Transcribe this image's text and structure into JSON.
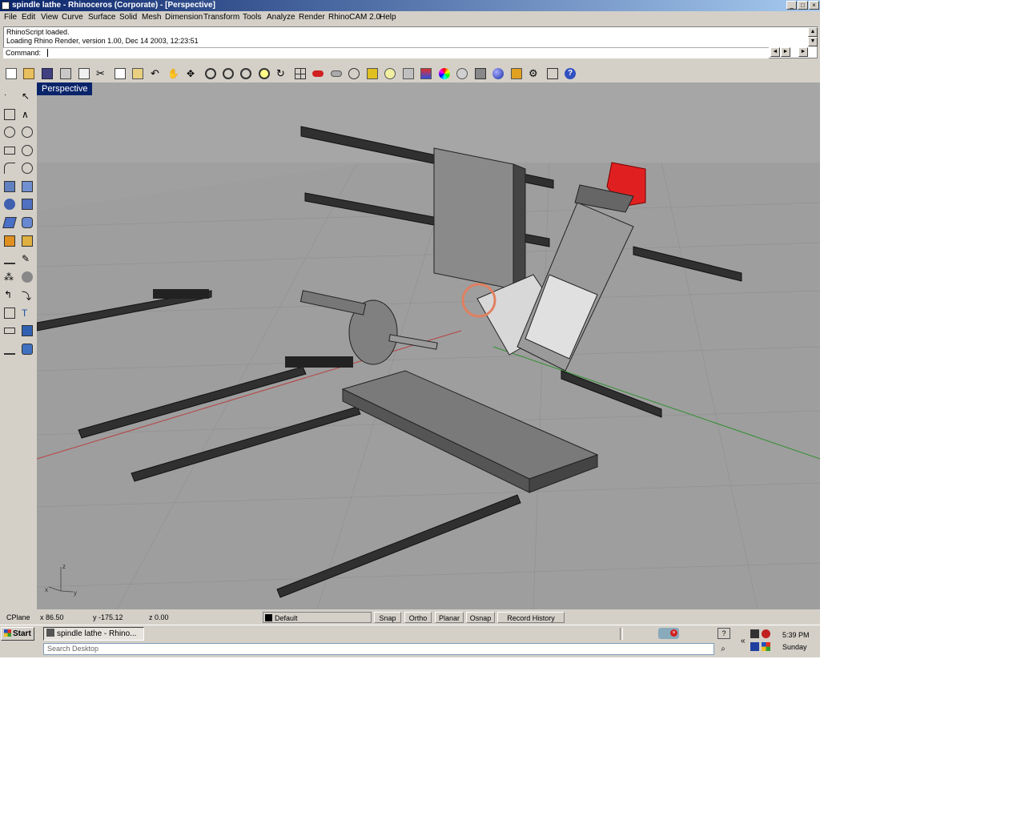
{
  "window": {
    "title": "spindle lathe - Rhinoceros (Corporate) - [Perspective]",
    "controls": [
      "_",
      "□",
      "×"
    ]
  },
  "menu": [
    "File",
    "Edit",
    "View",
    "Curve",
    "Surface",
    "Solid",
    "Mesh",
    "Dimension",
    "Transform",
    "Tools",
    "Analyze",
    "Render",
    "RhinoCAM 2.0",
    "Help"
  ],
  "command": {
    "history": [
      "RhinoScript loaded.",
      "Loading Rhino Render, version 1.00, Dec 14 2003, 12:23:51"
    ],
    "prompt": "Command:"
  },
  "toolbar_icons": [
    "new-file-icon",
    "open-icon",
    "save-icon",
    "print-icon",
    "import-icon",
    "cut-icon",
    "copy-icon",
    "paste-icon",
    "undo-icon",
    "pan-icon",
    "rotate-view-icon",
    "zoom-window-icon",
    "zoom-dynamic-icon",
    "zoom-extents-icon",
    "zoom-selected-icon",
    "undo-view-icon",
    "four-viewports-icon",
    "car-icon",
    "car-outline-icon",
    "osnap-icon",
    "move-icon",
    "light-icon",
    "lock-icon",
    "layer-icon",
    "color-wheel-icon",
    "shaded-icon",
    "render-preview-icon",
    "sphere-render-icon",
    "flag-icon",
    "gear-icon",
    "options-icon",
    "help-icon"
  ],
  "left_tools": [
    "point-icon",
    "select-icon",
    "polyline-icon",
    "curve-icon",
    "circle-icon",
    "arc-icon",
    "rectangle-icon",
    "ellipse-icon",
    "fillet-icon",
    "polygon-icon",
    "surface-icon",
    "nurbs-surface-icon",
    "sphere-icon",
    "box-icon",
    "extrude-icon",
    "cylinder-icon",
    "boolean-icon",
    "solid-edit-icon",
    "split-icon",
    "trim-icon",
    "group-icon",
    "explode-icon",
    "array-icon",
    "offset-icon",
    "scale-icon",
    "transform-icon",
    "dimension-icon",
    "render-icon"
  ],
  "viewport": {
    "label": "Perspective",
    "axis_labels": {
      "z": "z",
      "x": "x",
      "y": "y"
    }
  },
  "status_bar": {
    "cplane": "CPlane",
    "x": "x 86.50",
    "y": "y -175.12",
    "z": "z 0.00",
    "layer": "Default",
    "buttons": [
      "Snap",
      "Ortho",
      "Planar",
      "Osnap",
      "Record History"
    ]
  },
  "taskbar": {
    "start": "Start",
    "task": "spindle lathe - Rhino...",
    "search_placeholder": "Search Desktop",
    "clock": "5:39 PM",
    "day": "Sunday"
  },
  "colors": {
    "titlebar_start": "#0a246a",
    "titlebar_end": "#a6caf0",
    "chrome": "#d4d0c8",
    "viewport_bg": "#a0a0a0",
    "motor_red": "#e02020",
    "axis_red": "#b84040",
    "axis_green": "#2f8f2f"
  }
}
